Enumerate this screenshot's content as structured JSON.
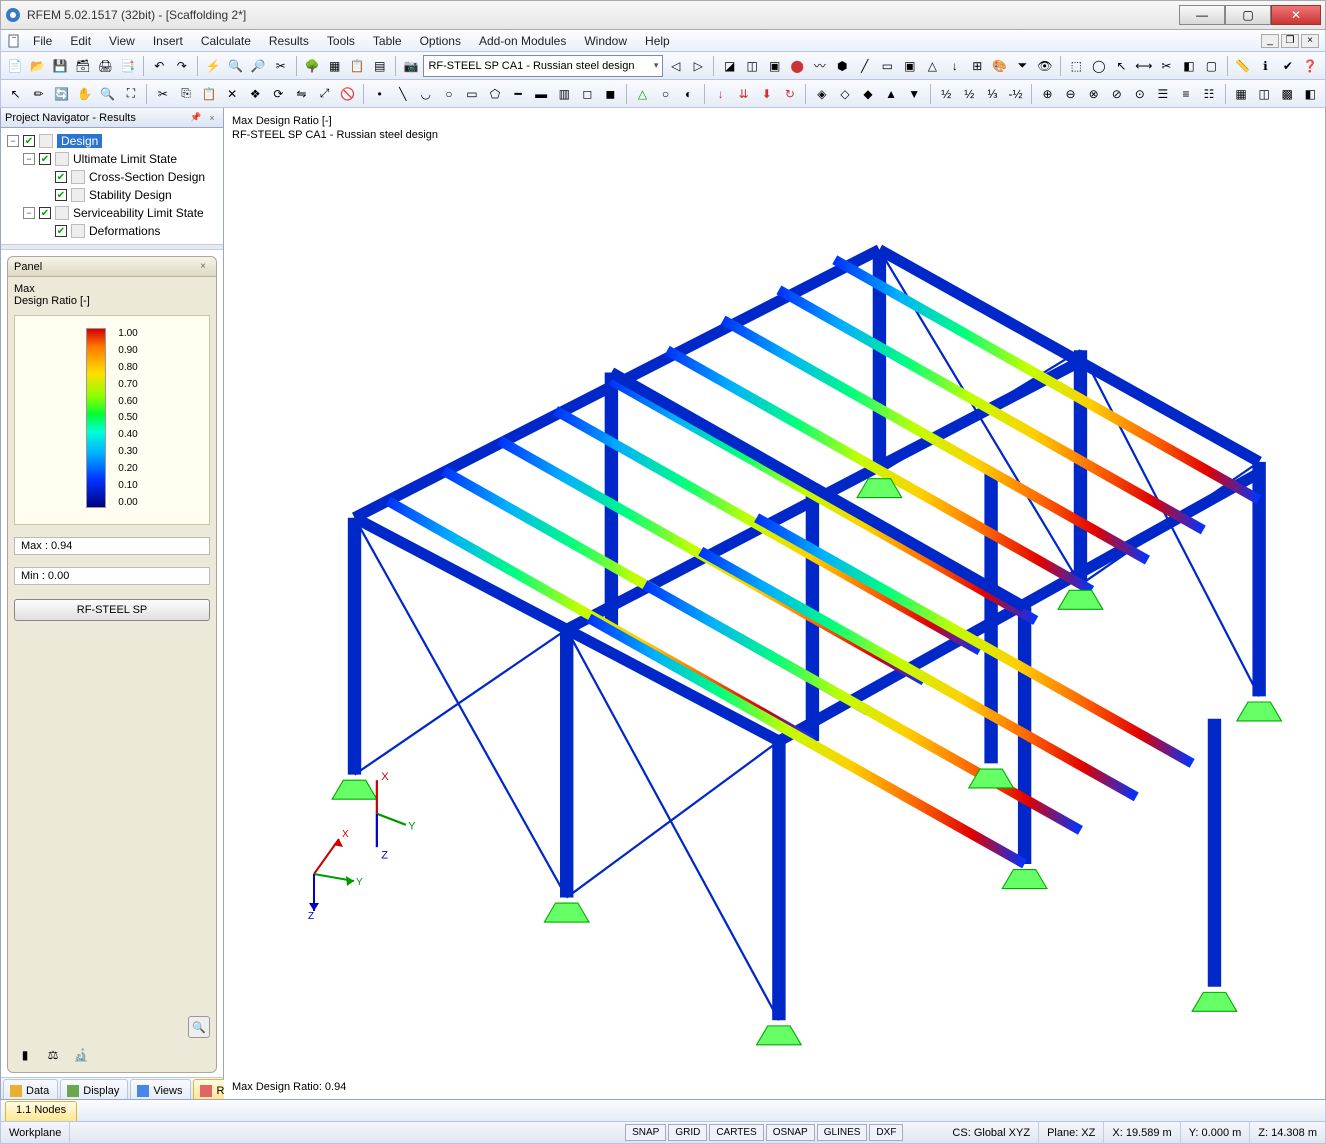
{
  "titlebar": {
    "text": "RFEM 5.02.1517 (32bit) - [Scaffolding 2*]"
  },
  "menu": {
    "items": [
      "File",
      "Edit",
      "View",
      "Insert",
      "Calculate",
      "Results",
      "Tools",
      "Table",
      "Options",
      "Add-on Modules",
      "Window",
      "Help"
    ]
  },
  "toolbar_dropdown": "RF-STEEL SP CA1 - Russian steel design",
  "navigator": {
    "title": "Project Navigator - Results",
    "tree": {
      "root": {
        "label": "Design",
        "selected": true
      },
      "uls": {
        "label": "Ultimate Limit State"
      },
      "cs": {
        "label": "Cross-Section Design"
      },
      "stab": {
        "label": "Stability Design"
      },
      "sls": {
        "label": "Serviceability Limit State"
      },
      "def": {
        "label": "Deformations"
      }
    },
    "tabs": [
      "Data",
      "Display",
      "Views",
      "Results"
    ]
  },
  "panel": {
    "title": "Panel",
    "heading": "Max",
    "sub": "Design Ratio [-]",
    "legend": [
      "1.00",
      "0.90",
      "0.80",
      "0.70",
      "0.60",
      "0.50",
      "0.40",
      "0.30",
      "0.20",
      "0.10",
      "0.00"
    ],
    "max_label": "Max  :",
    "max_val": "0.94",
    "min_label": "Min  :",
    "min_val": "0.00",
    "button": "RF-STEEL SP"
  },
  "viewport": {
    "line1": "Max Design Ratio [-]",
    "line2": "RF-STEEL SP CA1 - Russian steel design",
    "bottom": "Max Design Ratio: 0.94"
  },
  "bottom_tab": "1.1 Nodes",
  "status": {
    "left": "Workplane",
    "toggles": [
      "SNAP",
      "GRID",
      "CARTES",
      "OSNAP",
      "GLINES",
      "DXF"
    ],
    "cs": "CS: Global XYZ",
    "plane": "Plane: XZ",
    "x": "X:  19.589 m",
    "y": "Y:   0.000 m",
    "z": "Z:  14.308 m"
  },
  "chart_data": {
    "type": "table",
    "title": "Design Ratio color scale",
    "categories": [
      "0.00",
      "0.10",
      "0.20",
      "0.30",
      "0.40",
      "0.50",
      "0.60",
      "0.70",
      "0.80",
      "0.90",
      "1.00"
    ],
    "values": [
      0.0,
      0.1,
      0.2,
      0.3,
      0.4,
      0.5,
      0.6,
      0.7,
      0.8,
      0.9,
      1.0
    ],
    "max": 0.94,
    "min": 0.0
  }
}
